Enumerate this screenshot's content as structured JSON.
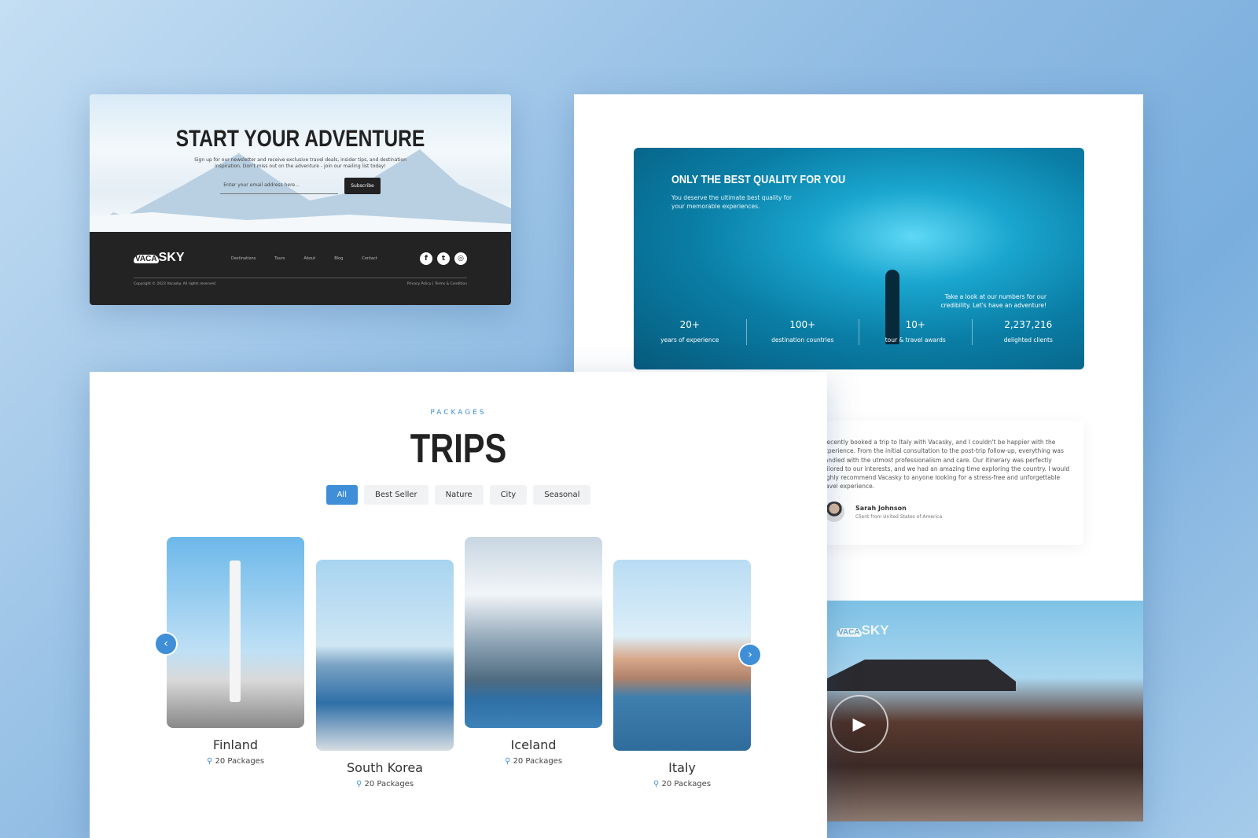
{
  "newsletter": {
    "title": "START YOUR ADVENTURE",
    "description": "Sign up for our newsletter and receive exclusive travel deals, insider tips, and destination inspiration. Don't miss out on the adventure - join our mailing list today!",
    "email_placeholder": "Enter your email address here...",
    "subscribe_label": "Subscribe"
  },
  "footer": {
    "logo": {
      "vaca": "VACA",
      "sky": "SKY"
    },
    "nav": [
      "Destinations",
      "Tours",
      "About",
      "Blog",
      "Contact"
    ],
    "social_icons": [
      "facebook-icon",
      "twitter-icon",
      "instagram-icon"
    ],
    "copyright": "Copyright © 2023 Vacasky. All rights reserved.",
    "privacy": "Privacy Policy",
    "separator": "|",
    "terms": "Terms & Condition"
  },
  "quality": {
    "title": "ONLY THE BEST QUALITY FOR YOU",
    "description": "You deserve the ultimate best quality for your memorable experiences.",
    "numbers_text": "Take a look at our numbers for our credibility. Let's have an adventure!",
    "stats": [
      {
        "value": "20+",
        "label": "years of experience"
      },
      {
        "value": "100+",
        "label": "destination countries"
      },
      {
        "value": "10+",
        "label": "tour & travel awards"
      },
      {
        "value": "2,237,216",
        "label": "delighted clients"
      }
    ]
  },
  "testimonial": {
    "text": "I recently booked a trip to Italy with Vacasky, and I couldn't be happier with the experience. From the initial consultation to the post-trip follow-up, everything was handled with the utmost professionalism and care. Our itinerary was perfectly tailored to our interests, and we had an amazing time exploring the country. I would highly recommend Vacasky to anyone looking for a stress-free and unforgettable travel experience.",
    "name": "Sarah Johnson",
    "role": "Client from United States of America"
  },
  "video": {
    "logo": {
      "vaca": "VACA",
      "sky": "SKY"
    }
  },
  "trips": {
    "eyebrow": "PACKAGES",
    "title": "TRIPS",
    "filters": [
      "All",
      "Best Seller",
      "Nature",
      "City",
      "Seasonal"
    ],
    "active_filter": "All",
    "accent": "#3f8fd8",
    "cards": [
      {
        "name": "Finland",
        "packages": "20 Packages"
      },
      {
        "name": "South Korea",
        "packages": "20 Packages"
      },
      {
        "name": "Iceland",
        "packages": "20 Packages"
      },
      {
        "name": "Italy",
        "packages": "20 Packages"
      }
    ]
  }
}
